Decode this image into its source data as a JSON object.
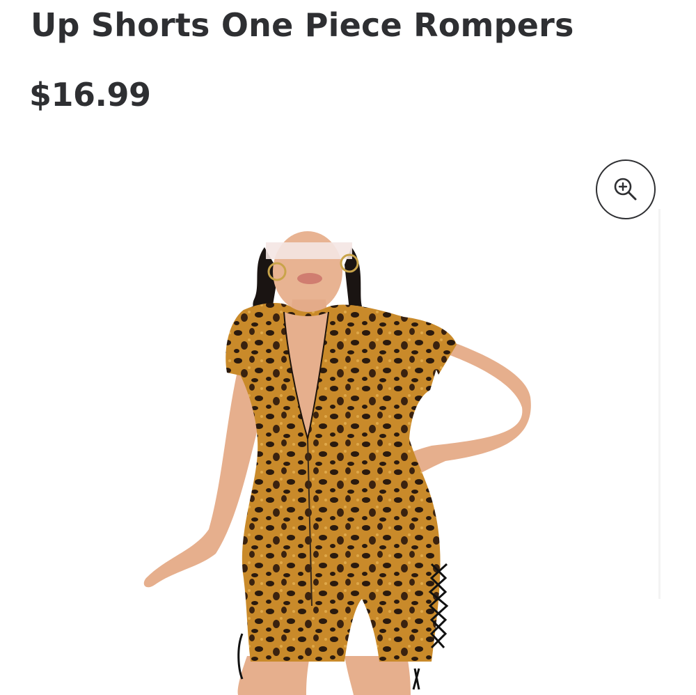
{
  "product": {
    "title": "Up Shorts One Piece Rompers",
    "price": "$16.99"
  },
  "image": {
    "alt": "Leopard print short sleeve zip-up romper with lace-up sides"
  },
  "zoom_button": {
    "icon": "zoom-in-icon"
  },
  "colors": {
    "text": "#2e2f32",
    "background": "#ffffff",
    "leopard_base": "#c98a2a",
    "leopard_spot": "#2a1a0e",
    "skin": "#e8b392"
  }
}
